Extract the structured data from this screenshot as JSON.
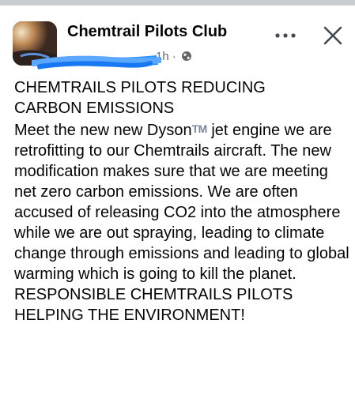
{
  "post": {
    "group_name": "Chemtrail Pilots Club",
    "author_name": "redacted",
    "time": "1h",
    "separator": "·",
    "headline_1": "CHEMTRAILS PILOTS REDUCING",
    "headline_2": "CARBON EMISSIONS",
    "body_part1": "Meet the new new Dyson",
    "trademark": "TM",
    "body_part2": " jet engine we are retrofitting to our Chemtrails aircraft. The new modification makes sure that we are meeting net zero carbon emissions. We are often accused of releasing CO2 into the atmosphere while we are out spraying, leading to climate change through emissions and leading to global warming which is going to kill the planet.",
    "closing_1": "RESPONSIBLE CHEMTRAILS PILOTS",
    "closing_2": "HELPING THE ENVIRONMENT!"
  },
  "icons": {
    "privacy": "globe-icon",
    "more": "more-options-icon",
    "close": "close-icon"
  },
  "colors": {
    "text": "#050505",
    "secondary_text": "#65676b",
    "redaction": "#1e8eff",
    "topbar": "#c9ccd1"
  }
}
